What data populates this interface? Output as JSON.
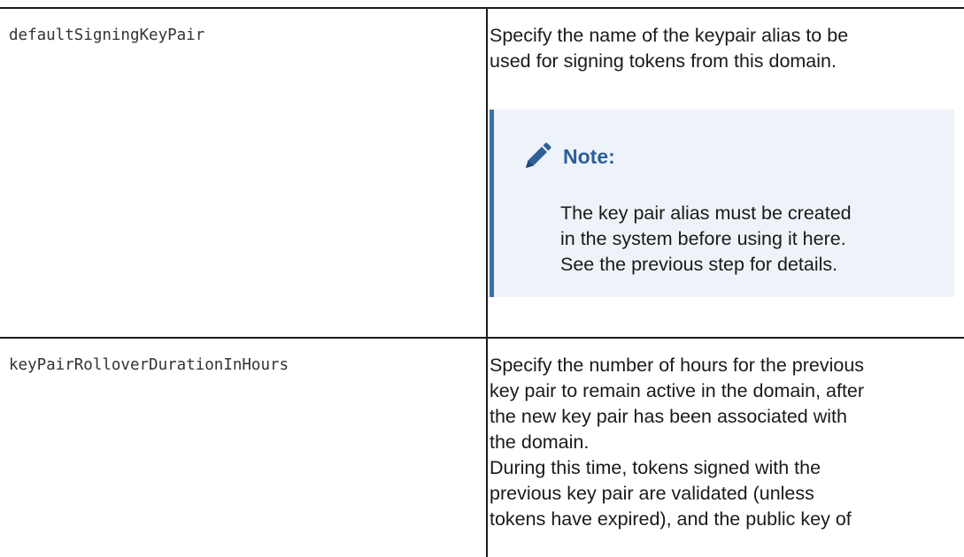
{
  "rows": [
    {
      "param": "defaultSigningKeyPair",
      "description": [
        "Specify the name of the keypair alias to be",
        "used for signing tokens from this domain."
      ],
      "note": {
        "icon": "pencil-icon",
        "title": "Note:",
        "body": [
          "The key pair alias must be created",
          "in the system before using it here.",
          "See the previous step for details."
        ]
      }
    },
    {
      "param": "keyPairRolloverDurationInHours",
      "description": [
        "Specify the number of hours for the previous",
        "key pair to remain active in the domain, after",
        "the new key pair has been associated with",
        "the domain.",
        "During this time, tokens signed with the",
        "previous key pair are validated (unless",
        "tokens have expired), and the public key of"
      ]
    }
  ],
  "colors": {
    "note_accent": "#3d6fa8",
    "note_background": "#eef3f9",
    "note_title": "#2e5f99"
  }
}
